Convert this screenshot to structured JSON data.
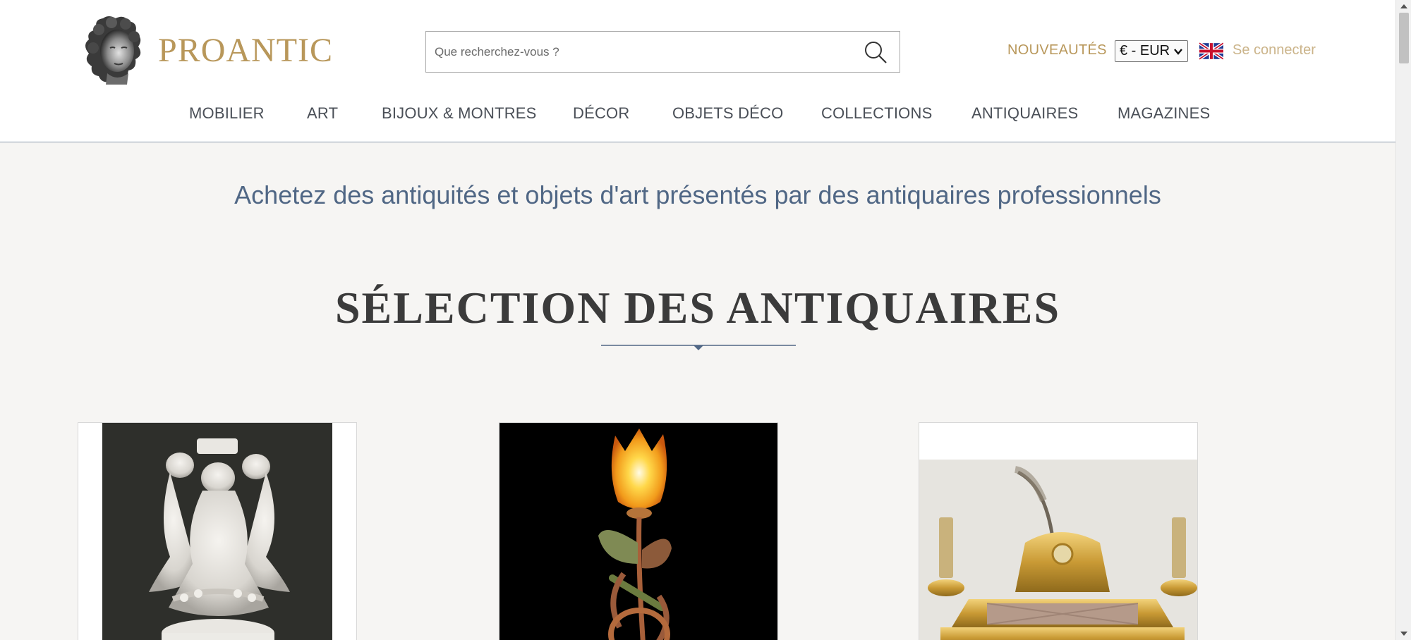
{
  "brand": {
    "name": "PROANTIC",
    "logo_icon": "bust-icon"
  },
  "search": {
    "placeholder": "Que recherchez-vous ?",
    "icon": "search-icon"
  },
  "header_links": {
    "nouveautes": "NOUVEAUTÉS",
    "currency": "€ - EUR",
    "language_flag": "uk-flag-icon",
    "login": "Se connecter"
  },
  "nav": {
    "items": [
      {
        "label": "MOBILIER"
      },
      {
        "label": "ART"
      },
      {
        "label": "BIJOUX & MONTRES"
      },
      {
        "label": "DÉCOR"
      },
      {
        "label": "OBJETS DÉCO"
      },
      {
        "label": "COLLECTIONS"
      },
      {
        "label": "ANTIQUAIRES"
      },
      {
        "label": "MAGAZINES"
      }
    ]
  },
  "main": {
    "tagline": "Achetez des antiquités et objets d'art présentés par des antiquaires professionnels",
    "section_title": "SÉLECTION DES ANTIQUAIRES"
  },
  "products": [
    {
      "image": "white-marble-sculpture"
    },
    {
      "image": "art-nouveau-tulip-lamp"
    },
    {
      "image": "gilt-bronze-inkwell"
    }
  ],
  "colors": {
    "gold": "#b8975a",
    "gold_light": "#cbb48a",
    "blue_text": "#506785",
    "nav_text": "#4a4f57",
    "background": "#f6f5f3"
  }
}
